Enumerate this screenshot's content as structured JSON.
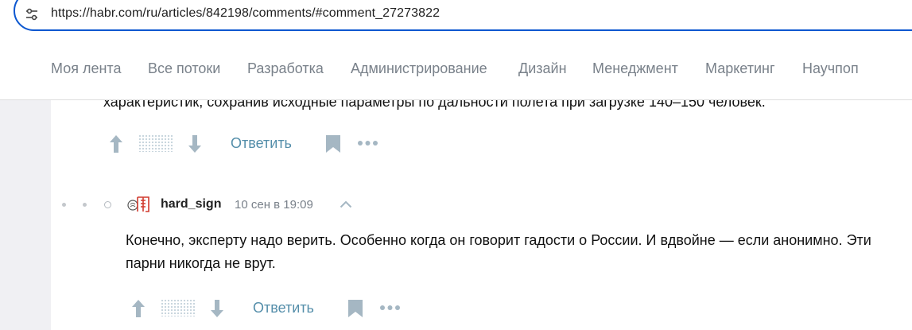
{
  "browser": {
    "url": "https://habr.com/ru/articles/842198/comments/#comment_27273822",
    "site_icon": "tune-icon"
  },
  "nav": {
    "items": [
      "Моя лента",
      "Все потоки",
      "Разработка",
      "Администрирование",
      "Дизайн",
      "Менеджмент",
      "Маркетинг",
      "Научпоп"
    ]
  },
  "previous_comment": {
    "text_tail": "характеристик, сохранив исходные параметры по дальности полета при загрузке 140–150 человек.",
    "reply_label": "Ответить"
  },
  "comment": {
    "username": "hard_sign",
    "timestamp": "10 сен в 19:09",
    "avatar_icon": "avatar-icon",
    "text": "Конечно, эксперту надо верить. Особенно когда он говорит гадости о России. И вдвойне — если анонимно. Эти парни никогда не врут.",
    "reply_label": "Ответить"
  },
  "colors": {
    "accent": "#0b57d0",
    "link": "#548eaa",
    "muted": "#79818a",
    "icon": "#a5b7c3",
    "background": "#f0f0f3"
  }
}
